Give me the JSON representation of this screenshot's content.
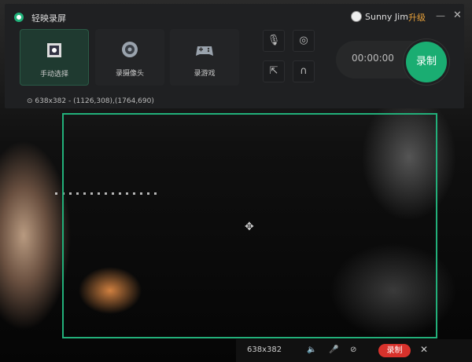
{
  "app": {
    "title": "轻映录屏",
    "user": "Sunny Jim",
    "upgrade": "升级"
  },
  "modes": [
    {
      "label": "手动选择",
      "icon": "region-select-icon"
    },
    {
      "label": "录摄像头",
      "icon": "webcam-icon"
    },
    {
      "label": "录游戏",
      "icon": "gamepad-icon"
    }
  ],
  "timer": "00:00:00",
  "record_label": "录制",
  "region_info": "638x382 - (1126,308),(1764,690)",
  "bottom_bar": {
    "size": "638x382",
    "record_label": "录制"
  },
  "colors": {
    "accent": "#1aad72",
    "upgrade": "#e8a13a",
    "record_red": "#d8322c"
  }
}
